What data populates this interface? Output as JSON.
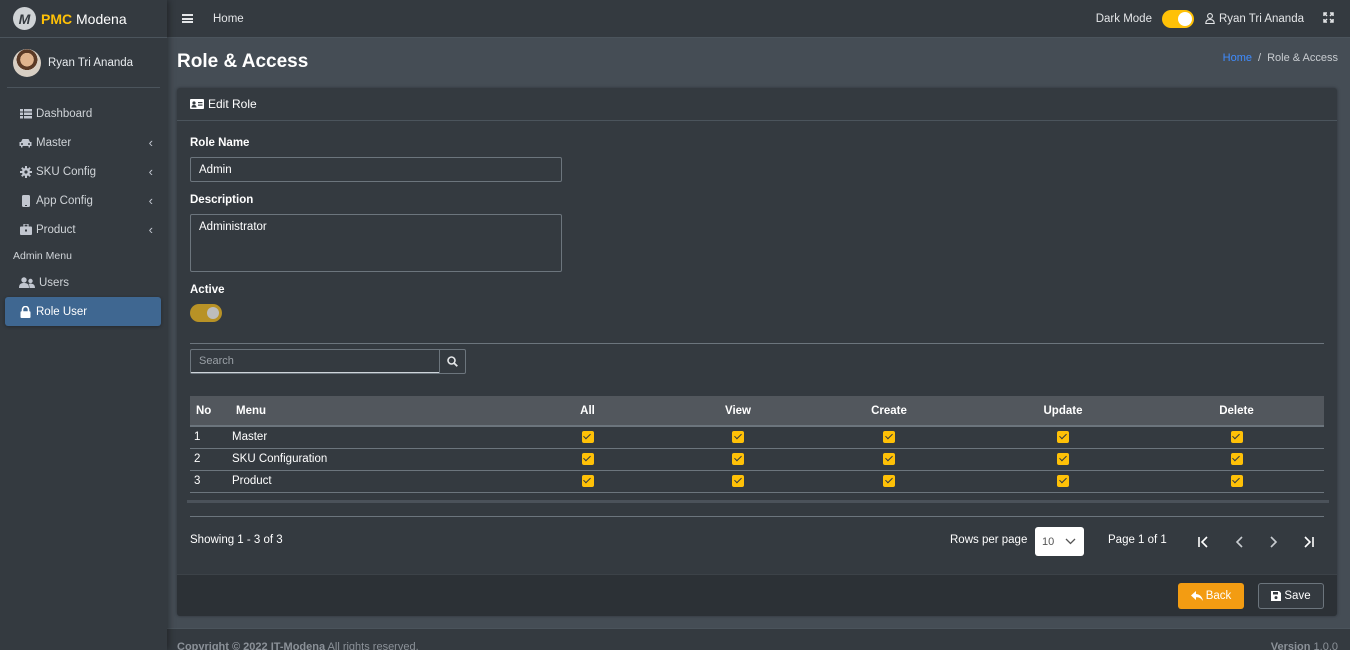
{
  "brand": {
    "logo_letter": "M",
    "pmc": "PMC",
    "name": "Modena"
  },
  "sidebar": {
    "user_name": "Ryan Tri Ananda",
    "items": [
      {
        "label": "Dashboard",
        "icon": "grid-icon"
      },
      {
        "label": "Master",
        "icon": "car-icon"
      },
      {
        "label": "SKU Config",
        "icon": "gear-icon"
      },
      {
        "label": "App Config",
        "icon": "phone-icon"
      },
      {
        "label": "Product",
        "icon": "briefcase-icon"
      }
    ],
    "section_header": "Admin Menu",
    "admin_items": [
      {
        "label": "Users",
        "icon": "users-icon"
      },
      {
        "label": "Role User",
        "icon": "lock-icon",
        "active": true
      }
    ]
  },
  "topbar": {
    "home": "Home",
    "dark_mode_label": "Dark Mode",
    "dark_mode_on": true,
    "user_name": "Ryan Tri Ananda"
  },
  "page": {
    "title": "Role & Access",
    "breadcrumb_home": "Home",
    "breadcrumb_sep": "/",
    "breadcrumb_current": "Role & Access"
  },
  "card": {
    "header": "Edit Role",
    "role_name_label": "Role Name",
    "role_name_value": "Admin",
    "description_label": "Description",
    "description_value": "Administrator",
    "active_label": "Active",
    "active_on": true,
    "search_placeholder": "Search"
  },
  "table": {
    "headers": {
      "no": "No",
      "menu": "Menu",
      "all": "All",
      "view": "View",
      "create": "Create",
      "update": "Update",
      "delete": "Delete"
    },
    "rows": [
      {
        "no": "1",
        "menu": "Master",
        "all": true,
        "view": true,
        "create": true,
        "update": true,
        "delete": true
      },
      {
        "no": "2",
        "menu": "SKU Configuration",
        "all": true,
        "view": true,
        "create": true,
        "update": true,
        "delete": true
      },
      {
        "no": "3",
        "menu": "Product",
        "all": true,
        "view": true,
        "create": true,
        "update": true,
        "delete": true
      }
    ]
  },
  "pagination": {
    "showing": "Showing 1 - 3 of 3",
    "rows_per_page_label": "Rows per page",
    "rows_per_page_value": "10",
    "page_info": "Page 1 of 1"
  },
  "actions": {
    "back": "Back",
    "save": "Save"
  },
  "footer": {
    "copyright_prefix": "Copyright © 2022",
    "company": "IT-Modena",
    "rights": "All rights reserved.",
    "version_label": "Version",
    "version": "1.0.0"
  },
  "colors": {
    "accent": "#ffc107",
    "active_nav": "#3f6791",
    "back_button": "#f39c12",
    "link": "#3f8cff"
  }
}
